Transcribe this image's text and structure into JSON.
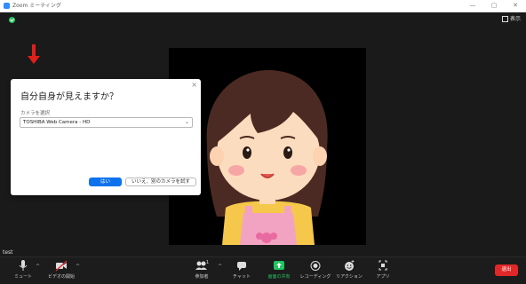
{
  "window": {
    "title": "Zoom ミーティング",
    "controls": [
      "—",
      "▢",
      "✕"
    ]
  },
  "stage": {
    "view_label": "表示",
    "participant_name": "test"
  },
  "dialog": {
    "title": "自分自身が見えますか？",
    "camera_label": "カメラを選択",
    "camera_value": "TOSHIBA Web Camera - HD",
    "yes_label": "はい",
    "no_label": "いいえ、別のカメラを試す",
    "close_glyph": "×"
  },
  "toolbar": {
    "mute_label": "ミュート",
    "video_label": "ビデオの開始",
    "participants_label": "参加者",
    "participants_count": "1",
    "chat_label": "チャット",
    "share_label": "画面の共有",
    "record_label": "レコーディング",
    "reactions_label": "リアクション",
    "apps_label": "アプリ",
    "end_label": "退出"
  },
  "colors": {
    "accent": "#0e72ed",
    "share_green": "#22c55e",
    "end_red": "#e02828",
    "arrow_red": "#e0201a",
    "background": "#1a1a1a"
  }
}
